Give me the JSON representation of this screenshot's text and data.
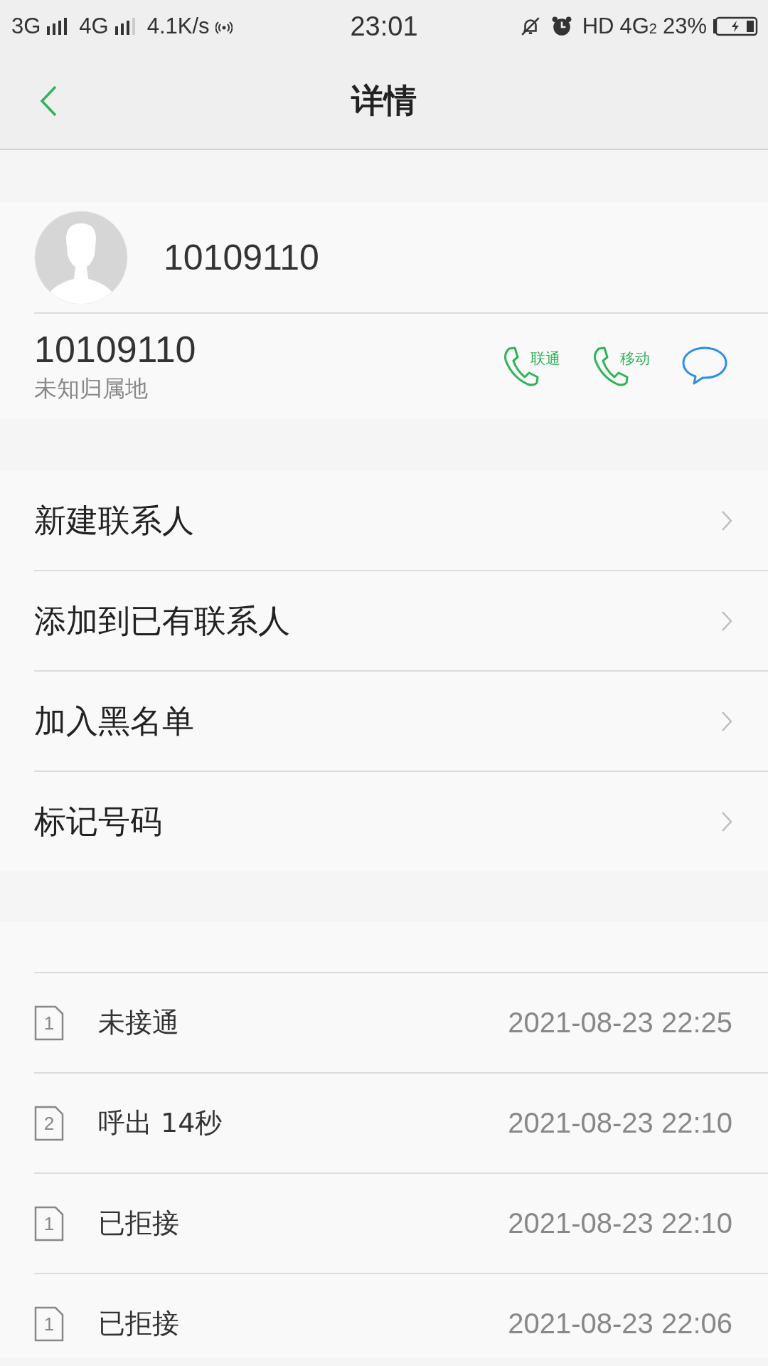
{
  "status_bar": {
    "network_1": "3G",
    "network_2": "4G",
    "speed": "4.1K/s",
    "time": "23:01",
    "hd": "HD",
    "volte": "4G",
    "volte_sim": "2",
    "battery": "23%"
  },
  "header": {
    "title": "详情"
  },
  "contact": {
    "name": "10109110",
    "number": "10109110",
    "location": "未知归属地",
    "call_buttons": [
      {
        "label": "联通"
      },
      {
        "label": "移动"
      }
    ]
  },
  "menu": [
    {
      "label": "新建联系人"
    },
    {
      "label": "添加到已有联系人"
    },
    {
      "label": "加入黑名单"
    },
    {
      "label": "标记号码"
    }
  ],
  "call_log": [
    {
      "sim": "1",
      "text": "未接通",
      "time": "2021-08-23 22:25"
    },
    {
      "sim": "2",
      "text": "呼出 14秒",
      "time": "2021-08-23 22:10"
    },
    {
      "sim": "1",
      "text": "已拒接",
      "time": "2021-08-23 22:10"
    },
    {
      "sim": "1",
      "text": "已拒接",
      "time": "2021-08-23 22:06"
    }
  ]
}
